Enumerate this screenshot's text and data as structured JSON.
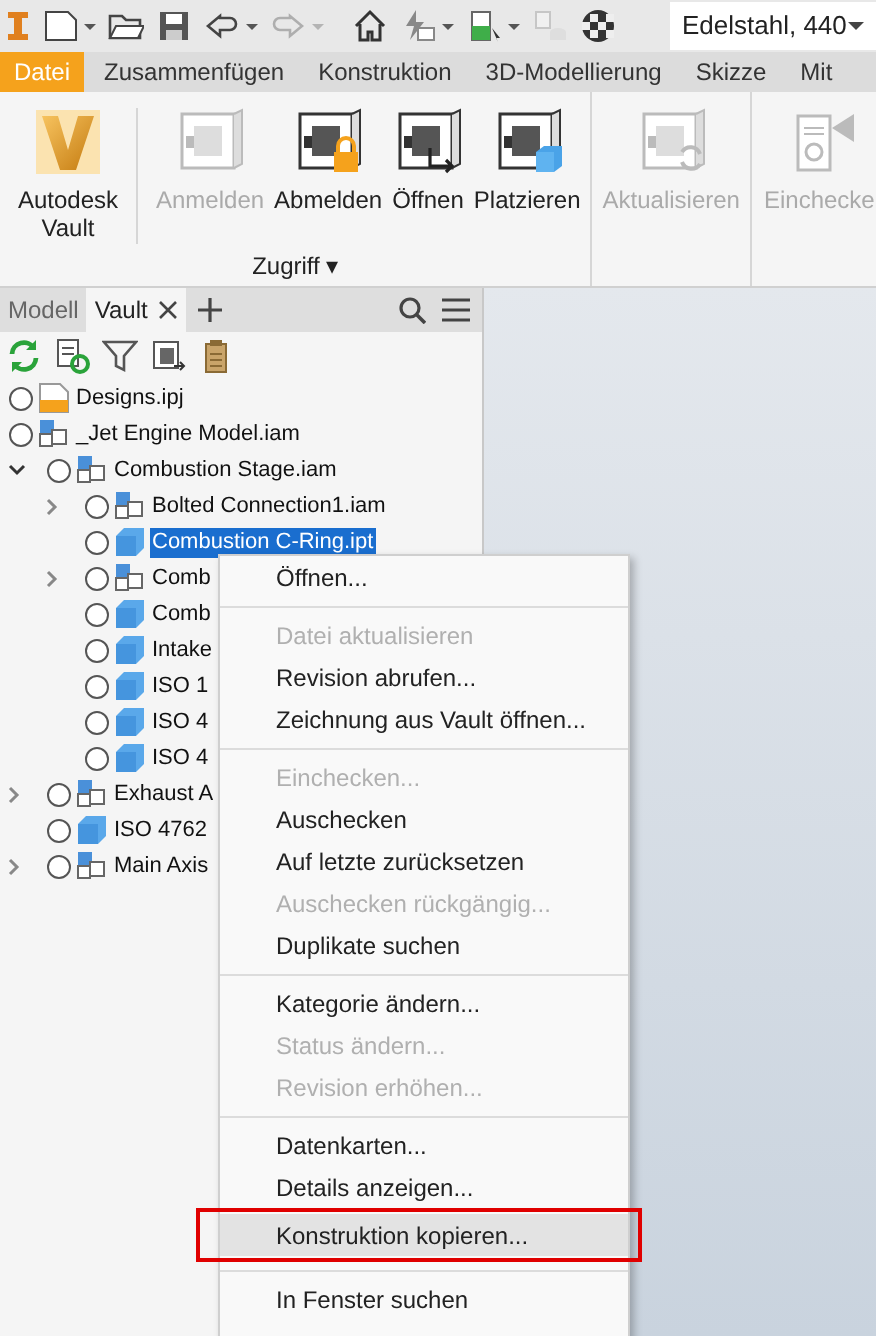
{
  "quick_access": {
    "tools": [
      {
        "kind": "new",
        "dropdown": true,
        "disabled": false
      },
      {
        "kind": "open",
        "dropdown": false,
        "disabled": false
      },
      {
        "kind": "save",
        "dropdown": false,
        "disabled": false
      },
      {
        "kind": "undo",
        "dropdown": true,
        "disabled": false
      },
      {
        "kind": "redo",
        "dropdown": true,
        "disabled": true
      },
      {
        "kind": "home",
        "dropdown": false,
        "disabled": false
      },
      {
        "kind": "update",
        "dropdown": true,
        "disabled": false
      },
      {
        "kind": "part",
        "dropdown": true,
        "disabled": false
      },
      {
        "kind": "link",
        "dropdown": false,
        "disabled": true
      },
      {
        "kind": "ball",
        "dropdown": false,
        "disabled": false
      }
    ],
    "material": "Edelstahl, 440"
  },
  "ribbon": {
    "tabs": [
      {
        "label": "Datei",
        "selected": true
      },
      {
        "label": "Zusammenfügen",
        "selected": false
      },
      {
        "label": "Konstruktion",
        "selected": false
      },
      {
        "label": "3D-Modellierung",
        "selected": false
      },
      {
        "label": "Skizze",
        "selected": false
      },
      {
        "label": "Mit",
        "selected": false
      }
    ],
    "groups": [
      {
        "label": "Zugriff ▾",
        "buttons": [
          {
            "label": "Autodesk Vault",
            "kind": "vault",
            "disabled": false
          },
          {
            "label": "Anmelden",
            "kind": "safe",
            "disabled": true
          },
          {
            "label": "Abmelden",
            "kind": "lock",
            "disabled": false
          },
          {
            "label": "Öffnen",
            "kind": "open",
            "disabled": false
          },
          {
            "label": "Platzieren",
            "kind": "place",
            "disabled": false
          }
        ]
      },
      {
        "buttons": [
          {
            "label": "Aktualisieren",
            "kind": "refresh",
            "disabled": true
          }
        ]
      },
      {
        "buttons": [
          {
            "label": "Einchecke",
            "kind": "checkin",
            "disabled": true
          }
        ]
      }
    ]
  },
  "browser": {
    "tabs": [
      {
        "label": "Modell",
        "selected": false,
        "closable": false
      },
      {
        "label": "Vault",
        "selected": true,
        "closable": true
      }
    ],
    "tree": [
      {
        "label": "Designs.ipj",
        "kind": "project",
        "selected": false
      },
      {
        "label": "_Jet Engine Model.iam",
        "kind": "assembly",
        "selected": false,
        "children": [
          {
            "label": "Combustion Stage.iam",
            "kind": "assembly",
            "selected": false,
            "expanded": true,
            "children": [
              {
                "label": "Bolted Connection1.iam",
                "kind": "assembly",
                "selected": false,
                "expanded": false
              },
              {
                "label": "Combustion C-Ring.ipt",
                "kind": "part",
                "selected": true
              },
              {
                "label": "Comb",
                "kind": "assembly",
                "selected": false,
                "expanded": false
              },
              {
                "label": "Comb",
                "kind": "part",
                "selected": false
              },
              {
                "label": "Intake",
                "kind": "part",
                "selected": false
              },
              {
                "label": "ISO 1",
                "kind": "part",
                "selected": false
              },
              {
                "label": "ISO 4",
                "kind": "part",
                "selected": false
              },
              {
                "label": "ISO 4",
                "kind": "part",
                "selected": false
              }
            ]
          },
          {
            "label": "Exhaust A",
            "kind": "assembly",
            "selected": false,
            "expanded": false
          },
          {
            "label": "ISO 4762",
            "kind": "part",
            "selected": false
          },
          {
            "label": "Main Axis",
            "kind": "assembly",
            "selected": false,
            "expanded": false
          }
        ]
      }
    ]
  },
  "context_menu": [
    {
      "kind": "item",
      "label": "Öffnen...",
      "disabled": false,
      "highlighted": false
    },
    {
      "kind": "separator"
    },
    {
      "kind": "item",
      "label": "Datei aktualisieren",
      "disabled": true,
      "highlighted": false
    },
    {
      "kind": "item",
      "label": "Revision abrufen...",
      "disabled": false,
      "highlighted": false
    },
    {
      "kind": "item",
      "label": "Zeichnung aus Vault öffnen...",
      "disabled": false,
      "highlighted": false
    },
    {
      "kind": "separator"
    },
    {
      "kind": "item",
      "label": "Einchecken...",
      "disabled": true,
      "highlighted": false
    },
    {
      "kind": "item",
      "label": "Auschecken",
      "disabled": false,
      "highlighted": false
    },
    {
      "kind": "item",
      "label": "Auf letzte zurücksetzen",
      "disabled": false,
      "highlighted": false
    },
    {
      "kind": "item",
      "label": "Auschecken rückgängig...",
      "disabled": true,
      "highlighted": false
    },
    {
      "kind": "item",
      "label": "Duplikate suchen",
      "disabled": false,
      "highlighted": false
    },
    {
      "kind": "separator"
    },
    {
      "kind": "item",
      "label": "Kategorie ändern...",
      "disabled": false,
      "highlighted": false
    },
    {
      "kind": "item",
      "label": "Status ändern...",
      "disabled": true,
      "highlighted": false
    },
    {
      "kind": "item",
      "label": "Revision erhöhen...",
      "disabled": true,
      "highlighted": false
    },
    {
      "kind": "separator"
    },
    {
      "kind": "item",
      "label": "Datenkarten...",
      "disabled": false,
      "highlighted": false
    },
    {
      "kind": "item",
      "label": "Details anzeigen...",
      "disabled": false,
      "highlighted": false
    },
    {
      "kind": "item",
      "label": "Konstruktion kopieren...",
      "disabled": false,
      "highlighted": true
    },
    {
      "kind": "separator"
    },
    {
      "kind": "item",
      "label": "In Fenster suchen",
      "disabled": false,
      "highlighted": false
    }
  ]
}
